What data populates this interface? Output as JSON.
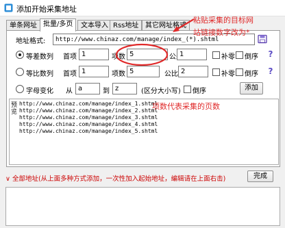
{
  "window": {
    "title": "添加开始采集地址"
  },
  "tabs": [
    {
      "label": "单条网址"
    },
    {
      "label": "批量/多页"
    },
    {
      "label": "文本导入"
    },
    {
      "label": "Rss地址"
    },
    {
      "label": "其它网址格式"
    }
  ],
  "address_format": {
    "label": "地址格式:",
    "value": "http://www.chinaz.com/manage/index_(*).shtml"
  },
  "arithmetic": {
    "label": "等差数列",
    "selected": true,
    "first_label": "首项",
    "first_value": "1",
    "count_label": "项数",
    "count_value": "5",
    "diff_label": "公差",
    "diff_value": "1",
    "pad_label": "补零",
    "reverse_label": "倒序"
  },
  "geometric": {
    "label": "等比数列",
    "selected": false,
    "first_label": "首项",
    "first_value": "1",
    "count_label": "项数",
    "count_value": "5",
    "ratio_label": "公比",
    "ratio_value": "2",
    "pad_label": "补零",
    "reverse_label": "倒序"
  },
  "letters": {
    "label": "字母变化",
    "selected": false,
    "from_label": "从",
    "from_value": "a",
    "to_label": "到",
    "to_value": "z",
    "case_note": "(区分大小写)",
    "reverse_label": "倒序"
  },
  "add_button": "添加",
  "preview": {
    "label": "预览",
    "lines": [
      "http://www.chinaz.com/manage/index_1.shtml",
      "http://www.chinaz.com/manage/index_2.shtml",
      "http://www.chinaz.com/manage/index_3.shtml",
      "http://www.chinaz.com/manage/index_4.shtml",
      "http://www.chinaz.com/manage/index_5.shtml"
    ]
  },
  "annotations": {
    "top_line1": "粘贴采集的目标网",
    "top_line2": "站链接数字改为*",
    "middle": "项数代表采集的页数",
    "color": "#e02a2a"
  },
  "footer": {
    "note": "∨ 全部地址(从上面多种方式添加，一次性加入起始地址，编辑请在上面右击)",
    "done_button": "完成"
  }
}
